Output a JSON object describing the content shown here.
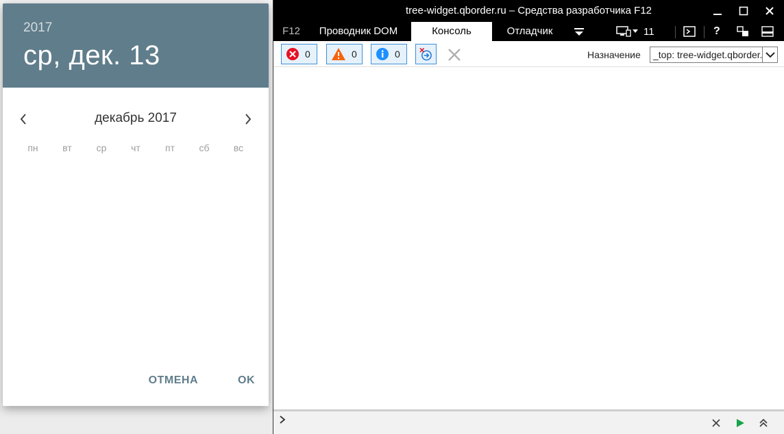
{
  "picker": {
    "year": "2017",
    "selected_date": "ср, дек. 13",
    "month_label": "декабрь 2017",
    "weekdays": [
      "пн",
      "вт",
      "ср",
      "чт",
      "пт",
      "сб",
      "вс"
    ],
    "cancel_label": "ОТМЕНА",
    "ok_label": "OK",
    "accent_color": "#607d8b"
  },
  "devtools": {
    "title": "tree-widget.qborder.ru – Средства разработчика F12",
    "tabs": {
      "f12": "F12",
      "dom": "Проводник DOM",
      "console": "Консоль",
      "debugger": "Отладчик"
    },
    "emulation_value": "11",
    "filters": {
      "errors": "0",
      "warnings": "0",
      "info": "0"
    },
    "target_label": "Назначение",
    "target_value": "_top: tree-widget.qborder.ru"
  }
}
